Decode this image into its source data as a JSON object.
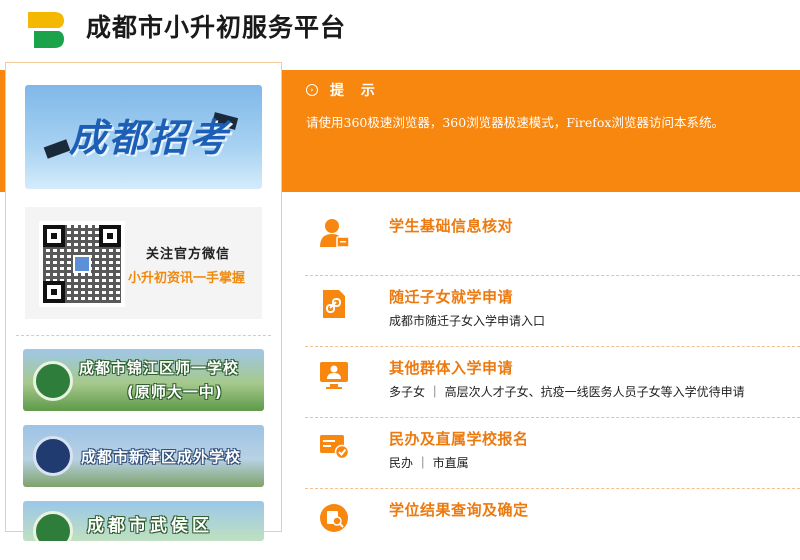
{
  "header": {
    "site_title": "成都市小升初服务平台"
  },
  "notice": {
    "title": "提 示",
    "message": "请使用360极速浏览器，360浏览器极速模式，Firefox浏览器访问本系统。"
  },
  "sidebar": {
    "banner_text": "成都招考",
    "wechat": {
      "line1": "关注官方微信",
      "line2": "小升初资讯一手掌握"
    },
    "schools": [
      {
        "line1": "成都市锦江区师一学校",
        "line2": "(原师大一中)"
      },
      {
        "line1": "成都市新津区成外学校"
      },
      {
        "line1": "成都市武侯区"
      }
    ]
  },
  "menu": {
    "items": [
      {
        "title": "学生基础信息核对",
        "subtitle": "",
        "icon": "student-id-icon"
      },
      {
        "title": "随迁子女就学申请",
        "subtitle": "成都市随迁子女入学申请入口",
        "icon": "document-link-icon"
      },
      {
        "title": "其他群体入学申请",
        "subtitle": "多子女 ｜ 高层次人才子女、抗疫一线医务人员子女等入学优待申请",
        "icon": "monitor-person-icon"
      },
      {
        "title": "民办及直属学校报名",
        "subtitle": "民办 ｜ 市直属",
        "icon": "card-check-icon"
      },
      {
        "title": "学位结果查询及确定",
        "subtitle": "",
        "icon": "search-result-icon"
      }
    ]
  },
  "colors": {
    "accent": "#f7870f",
    "title_orange": "#ec7a10",
    "separator": "#f2bf8f"
  }
}
